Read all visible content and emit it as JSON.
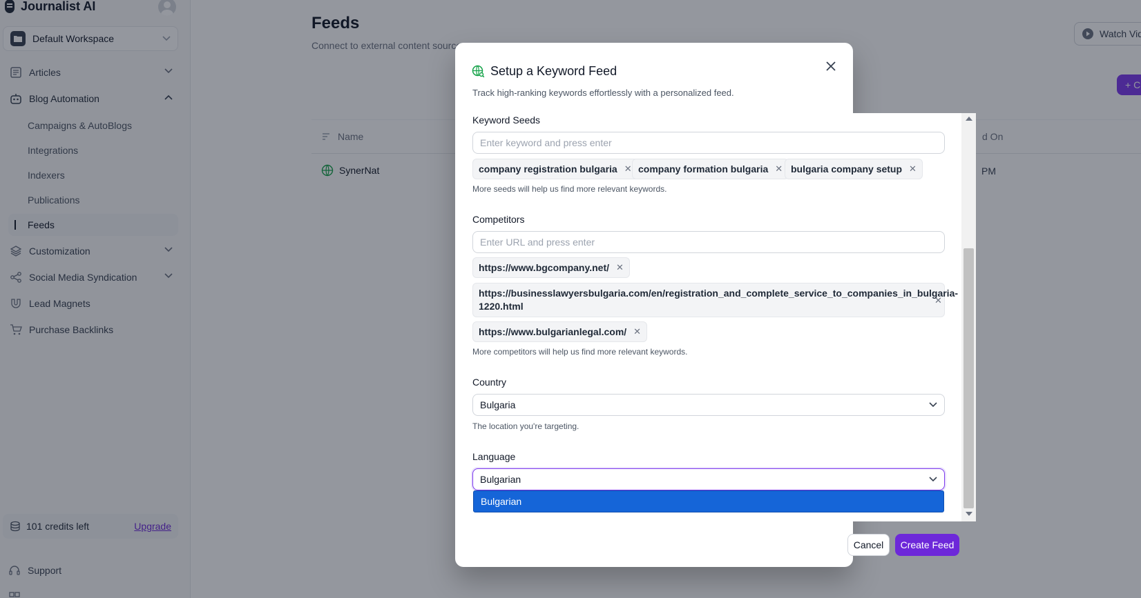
{
  "app": {
    "name": "Journalist AI",
    "workspace": "Default Workspace"
  },
  "sidebar": {
    "items": [
      {
        "label": "Articles"
      },
      {
        "label": "Blog Automation"
      },
      {
        "label": "Customization"
      },
      {
        "label": "Social Media Syndication"
      },
      {
        "label": "Lead Magnets"
      },
      {
        "label": "Purchase Backlinks"
      }
    ],
    "sub_items": [
      {
        "label": "Campaigns & AutoBlogs"
      },
      {
        "label": "Integrations"
      },
      {
        "label": "Indexers"
      },
      {
        "label": "Publications"
      },
      {
        "label": "Feeds"
      }
    ],
    "credits": "101 credits left",
    "upgrade": "Upgrade",
    "support": "Support"
  },
  "page": {
    "title": "Feeds",
    "subtitle": "Connect to external content sources",
    "watch_button": "Watch Vid",
    "add_button": "+ C",
    "table": {
      "col_name": "Name",
      "col_created": "d On",
      "rows": [
        {
          "name": "SynerNat",
          "created": "PM"
        }
      ]
    }
  },
  "modal": {
    "title": "Setup a Keyword Feed",
    "description": "Track high-ranking keywords effortlessly with a personalized feed.",
    "keyword_seeds": {
      "label": "Keyword Seeds",
      "placeholder": "Enter keyword and press enter",
      "chips": [
        "company registration bulgaria",
        "company formation bulgaria",
        "bulgaria company setup"
      ],
      "hint": "More seeds will help us find more relevant keywords."
    },
    "competitors": {
      "label": "Competitors",
      "placeholder": "Enter URL and press enter",
      "chips": [
        "https://www.bgcompany.net/",
        "https://businesslawyersbulgaria.com/en/registration_and_complete_service_to_companies_in_bulgaria-1220.html",
        "https://www.bulgarianlegal.com/"
      ],
      "hint": "More competitors will help us find more relevant keywords."
    },
    "country": {
      "label": "Country",
      "value": "Bulgaria",
      "hint": "The location you're targeting."
    },
    "language": {
      "label": "Language",
      "value": "Bulgarian",
      "options": [
        "Bulgarian"
      ]
    },
    "cancel": "Cancel",
    "create": "Create Feed"
  },
  "colors": {
    "accent": "#6d28d9",
    "dropdown_highlight": "#1565d8",
    "globe_icon": "#16a34a"
  }
}
